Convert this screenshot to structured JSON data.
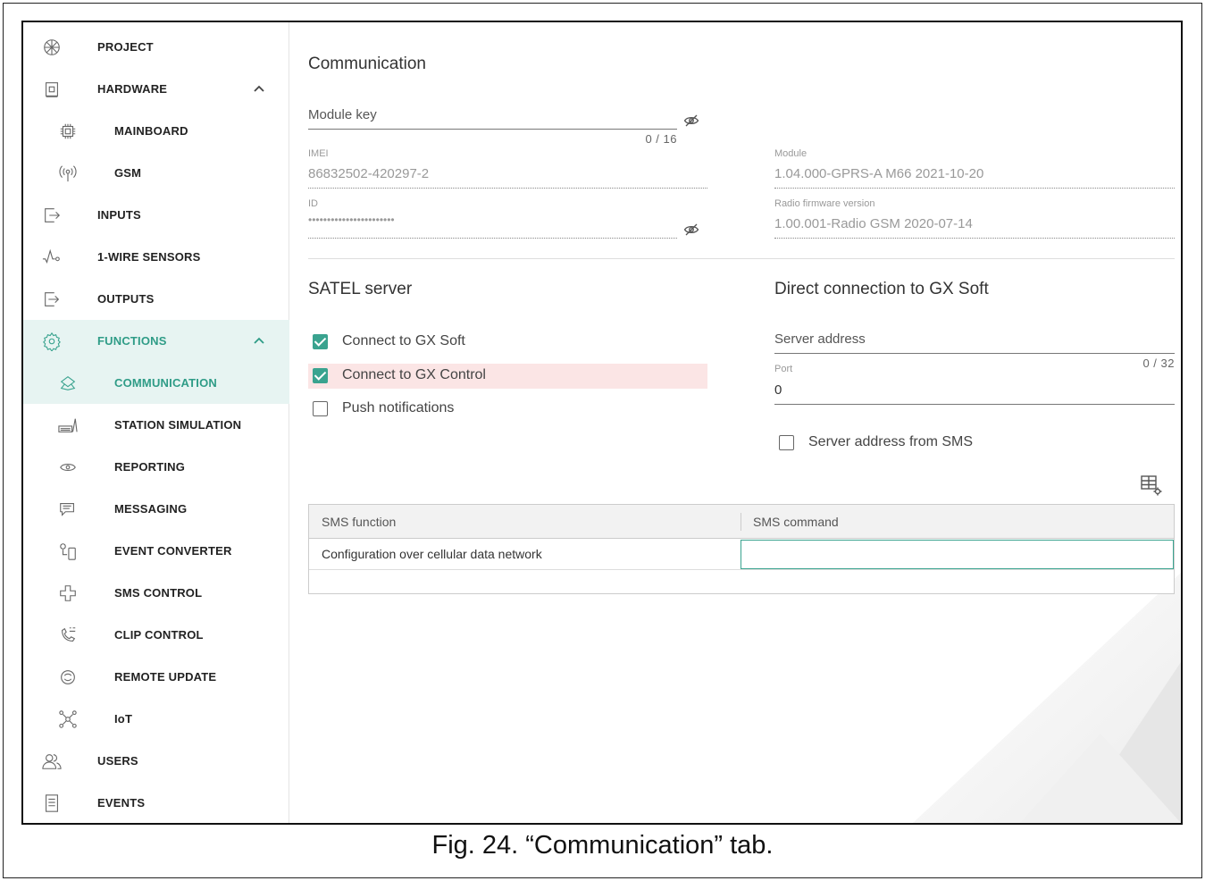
{
  "caption": "Fig. 24. “Communication” tab.",
  "colors": {
    "accent": "#3aa38f",
    "active_bg": "#e7f4f2",
    "highlight_row": "#fbe5e5"
  },
  "sidebar": {
    "items": [
      {
        "label": "PROJECT",
        "icon": "project-icon",
        "level": 0
      },
      {
        "label": "HARDWARE",
        "icon": "hardware-icon",
        "level": 0,
        "expanded": true
      },
      {
        "label": "MAINBOARD",
        "icon": "chip-icon",
        "level": 1
      },
      {
        "label": "GSM",
        "icon": "antenna-icon",
        "level": 1
      },
      {
        "label": "INPUTS",
        "icon": "input-icon",
        "level": 0
      },
      {
        "label": "1-WIRE SENSORS",
        "icon": "wire-sensor-icon",
        "level": 0
      },
      {
        "label": "OUTPUTS",
        "icon": "output-icon",
        "level": 0
      },
      {
        "label": "FUNCTIONS",
        "icon": "gear-icon",
        "level": 0,
        "expanded": true,
        "active": true
      },
      {
        "label": "COMMUNICATION",
        "icon": "communication-icon",
        "level": 1,
        "active": true
      },
      {
        "label": "STATION SIMULATION",
        "icon": "station-icon",
        "level": 1
      },
      {
        "label": "REPORTING",
        "icon": "eye-icon",
        "level": 1
      },
      {
        "label": "MESSAGING",
        "icon": "message-icon",
        "level": 1
      },
      {
        "label": "EVENT CONVERTER",
        "icon": "event-converter-icon",
        "level": 1
      },
      {
        "label": "SMS CONTROL",
        "icon": "sms-control-icon",
        "level": 1
      },
      {
        "label": "CLIP CONTROL",
        "icon": "clip-control-icon",
        "level": 1
      },
      {
        "label": "REMOTE UPDATE",
        "icon": "refresh-icon",
        "level": 1
      },
      {
        "label": "IoT",
        "icon": "iot-icon",
        "level": 1
      },
      {
        "label": "USERS",
        "icon": "users-icon",
        "level": 0
      },
      {
        "label": "EVENTS",
        "icon": "events-icon",
        "level": 0
      }
    ]
  },
  "main": {
    "title": "Communication",
    "module_key": {
      "label": "Module key",
      "value": "",
      "counter": "0 / 16"
    },
    "imei": {
      "label": "IMEI",
      "value": "86832502-420297-2"
    },
    "module": {
      "label": "Module",
      "value": "1.04.000-GPRS-A M66 2021-10-20"
    },
    "id": {
      "label": "ID",
      "value": "•••••••••••••••••••••••"
    },
    "radio_fw": {
      "label": "Radio firmware version",
      "value": "1.00.001-Radio GSM 2020-07-14"
    },
    "satel": {
      "title": "SATEL server",
      "options": [
        {
          "label": "Connect to GX Soft",
          "checked": true
        },
        {
          "label": "Connect to GX Control",
          "checked": true,
          "highlighted": true
        },
        {
          "label": "Push notifications",
          "checked": false
        }
      ]
    },
    "direct": {
      "title": "Direct connection to GX Soft",
      "server_address": {
        "label": "Server address",
        "value": "",
        "counter": "0 / 32"
      },
      "port": {
        "label": "Port",
        "value": "0"
      },
      "sms_option": {
        "label": "Server address from SMS",
        "checked": false
      }
    },
    "table": {
      "columns": [
        "SMS function",
        "SMS command"
      ],
      "rows": [
        {
          "function": "Configuration over cellular data network",
          "command": ""
        }
      ]
    }
  }
}
